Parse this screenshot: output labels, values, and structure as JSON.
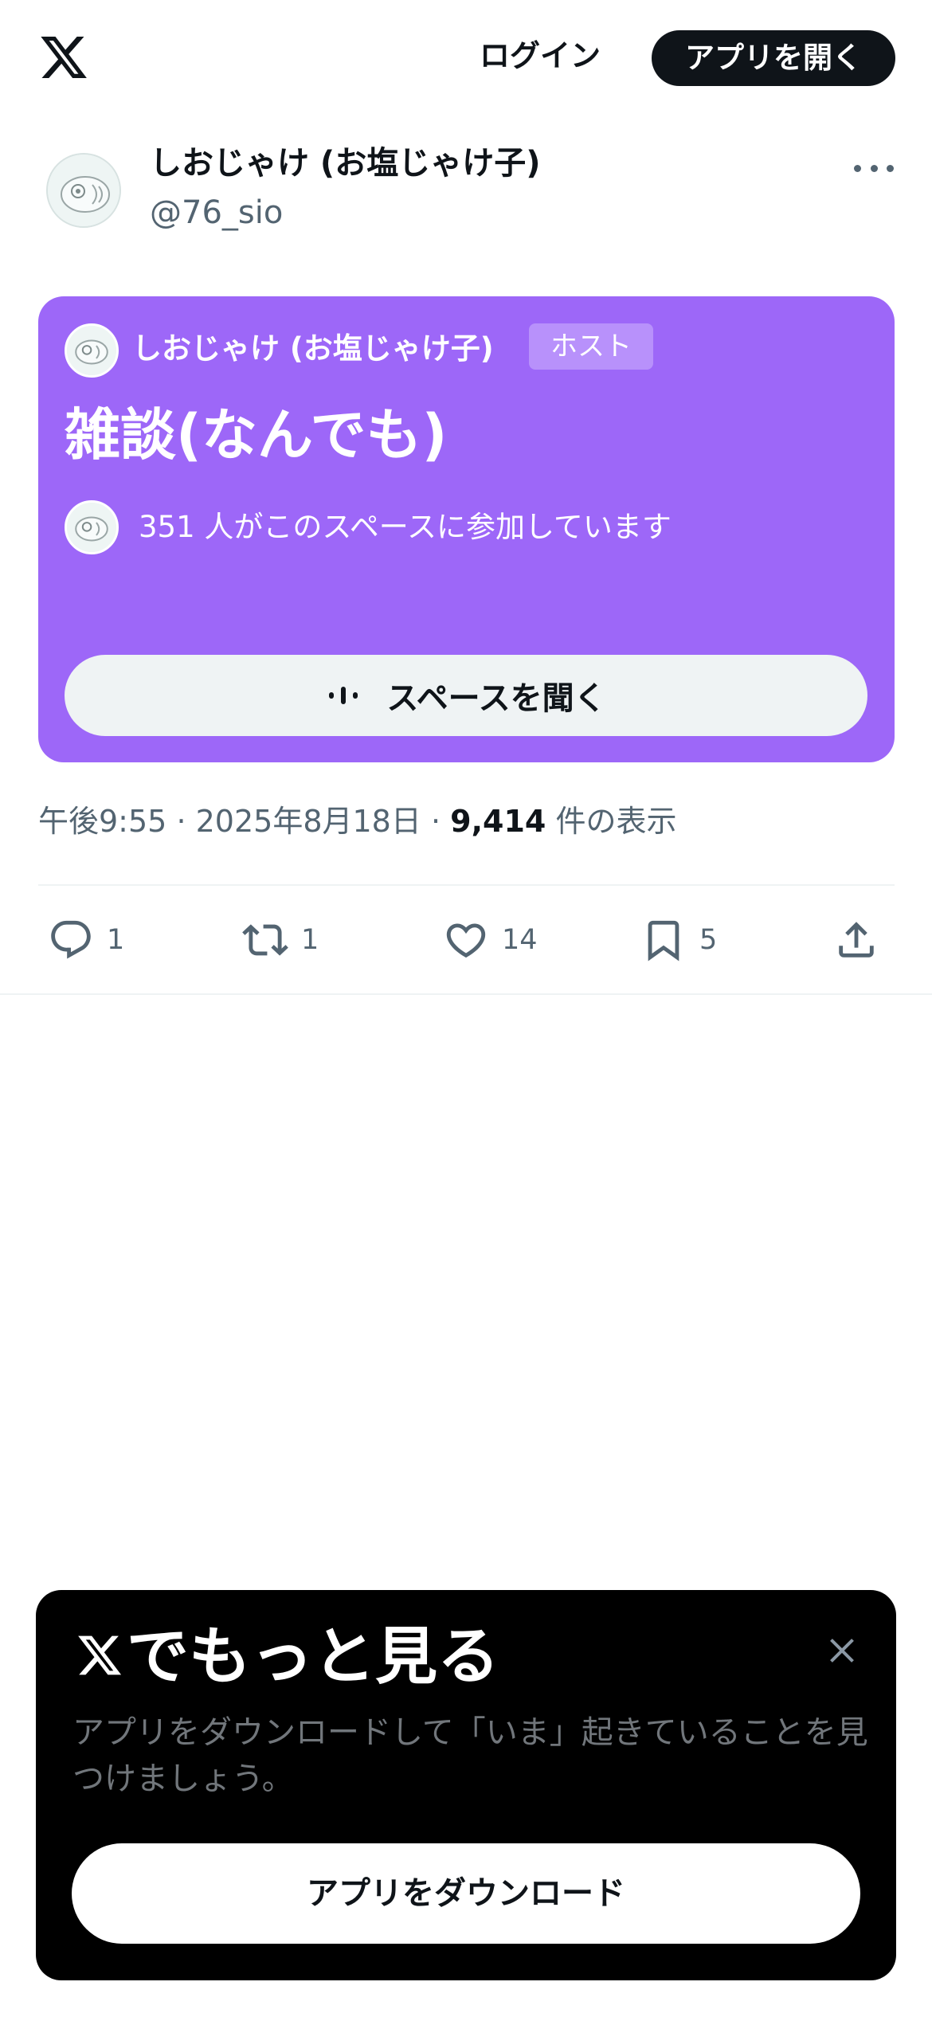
{
  "topbar": {
    "logo_icon": "x-logo-icon",
    "login_label": "ログイン",
    "open_app_label": "アプリを開く"
  },
  "post": {
    "author": {
      "display_name": "しおじゃけ (お塩じゃけ子)",
      "handle": "@76_sio",
      "avatar_icon": "avatar-image"
    },
    "more_icon": "more-dots-icon",
    "space": {
      "background_color": "#9d67f8",
      "host_name": "しおじゃけ (お塩じゃけ子)",
      "host_badge": "ホスト",
      "title": "雑談(なんでも)",
      "listener_text": "351 人がこのスペースに参加しています",
      "listen_label": "スペースを聞く",
      "listen_icon": "audio-wave-icon"
    },
    "meta": {
      "time": "午後9:55",
      "separator": "·",
      "date": "2025年8月18日",
      "views_count": "9,414",
      "views_label": "件の表示"
    },
    "actions": {
      "replies": "1",
      "reposts": "1",
      "likes": "14",
      "bookmarks": "5"
    }
  },
  "sheet": {
    "title": "でもっと見る",
    "description": "アプリをダウンロードして「いま」起きていることを見つけましょう。",
    "download_label": "アプリをダウンロード",
    "close_icon": "close-icon"
  }
}
